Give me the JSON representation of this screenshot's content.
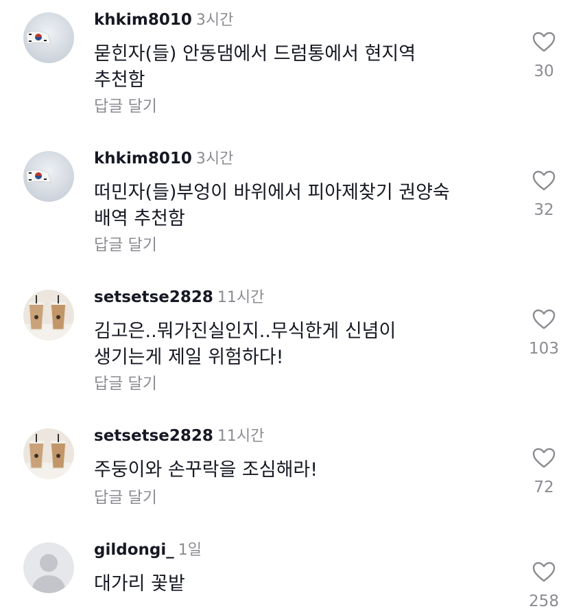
{
  "comments": [
    {
      "username": "khkim8010",
      "time": "3시간",
      "lines": [
        "묻힌자(들) 안동댐에서 드럼통에서 현지역",
        "추천함"
      ],
      "reply_label": "답글 달기",
      "likes": "30",
      "avatar": "flag-sky"
    },
    {
      "username": "khkim8010",
      "time": "3시간",
      "lines": [
        "떠민자(들)부엉이 바위에서 피아제찾기 권양숙",
        "배역 추천함"
      ],
      "reply_label": "답글 달기",
      "likes": "32",
      "avatar": "flag-sky"
    },
    {
      "username": "setsetse2828",
      "time": "11시간",
      "lines": [
        "김고은..뭐가진실인지..무식한게 신념이",
        "생기는게 제일 위험하다!"
      ],
      "reply_label": "답글 달기",
      "likes": "103",
      "avatar": "iced-coffee"
    },
    {
      "username": "setsetse2828",
      "time": "11시간",
      "lines": [
        "주둥이와 손꾸락을 조심해라!"
      ],
      "reply_label": "답글 달기",
      "likes": "72",
      "avatar": "iced-coffee"
    },
    {
      "username": "gildongi_",
      "time": "1일",
      "lines": [
        "대가리 꽃밭"
      ],
      "reply_label": "",
      "likes": "258",
      "avatar": "default-person"
    }
  ],
  "colors": {
    "text": "#161823",
    "secondary": "#8a8b91"
  }
}
